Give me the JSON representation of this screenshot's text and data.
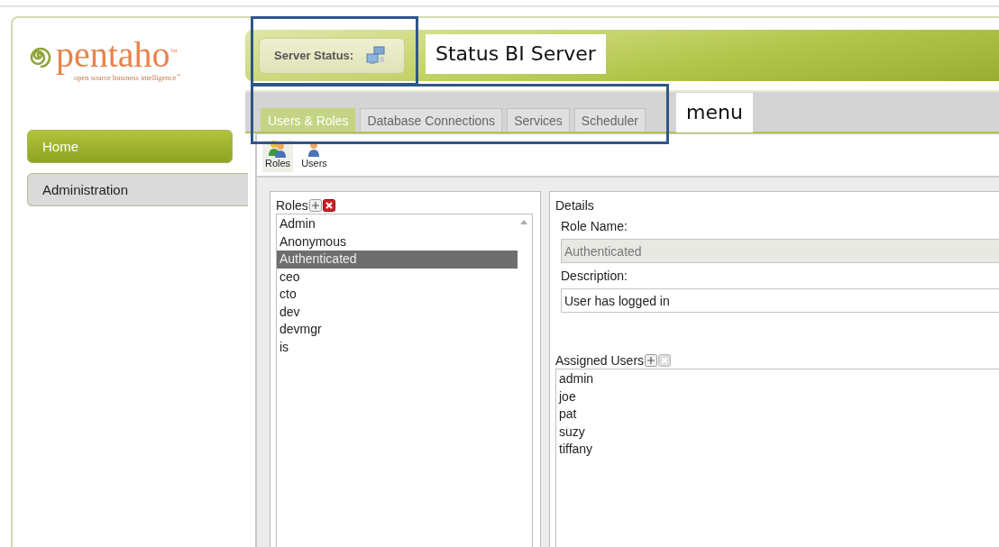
{
  "logo": {
    "name": "pentaho$^{™}$",
    "tagline": "open source business intelligence$^{™}$"
  },
  "nav": [
    {
      "label": "Home",
      "selected": false
    },
    {
      "label": "Administration",
      "selected": true
    }
  ],
  "server_status": {
    "label": "Server Status:"
  },
  "tabs": [
    {
      "label": "Users & Roles",
      "selected": true
    },
    {
      "label": "Database Connections",
      "selected": false
    },
    {
      "label": "Services",
      "selected": false
    },
    {
      "label": "Scheduler",
      "selected": false
    }
  ],
  "toolbar": [
    {
      "label": "Roles",
      "kind": "roles",
      "selected": true
    },
    {
      "label": "Users",
      "kind": "users",
      "selected": false
    }
  ],
  "roles": {
    "title": "Roles",
    "remove_disabled": false,
    "items": [
      {
        "label": "Admin",
        "selected": false
      },
      {
        "label": "Anonymous",
        "selected": false
      },
      {
        "label": "Authenticated",
        "selected": true
      },
      {
        "label": "ceo",
        "selected": false
      },
      {
        "label": "cto",
        "selected": false
      },
      {
        "label": "dev",
        "selected": false
      },
      {
        "label": "devmgr",
        "selected": false
      },
      {
        "label": "is",
        "selected": false
      }
    ]
  },
  "details": {
    "title": "Details",
    "role_name": {
      "label": "Role Name:",
      "value": "Authenticated",
      "disabled": true
    },
    "description": {
      "label": "Description:",
      "value": "User has logged in",
      "disabled": false
    },
    "assigned_users": {
      "title": "Assigned Users",
      "remove_disabled": true,
      "items": [
        "admin",
        "joe",
        "pat",
        "suzy",
        "tiffany"
      ]
    }
  },
  "annotations": [
    {
      "label": "Status BI Server"
    },
    {
      "label": "menu"
    }
  ]
}
